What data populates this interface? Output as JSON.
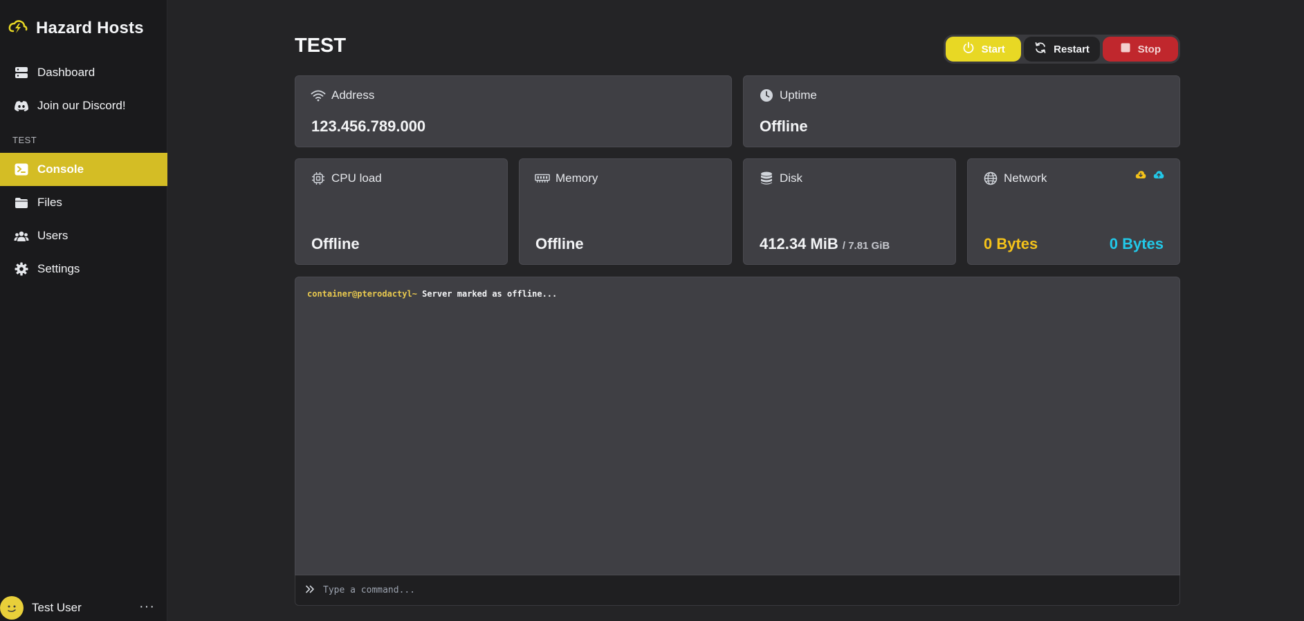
{
  "brand": {
    "name": "Hazard Hosts"
  },
  "nav": {
    "top_items": [
      {
        "label": "Dashboard",
        "icon": "server-stack-icon"
      },
      {
        "label": "Join our Discord!",
        "icon": "discord-icon"
      }
    ],
    "section_label": "TEST",
    "server_items": [
      {
        "label": "Console",
        "icon": "terminal-icon",
        "active": true
      },
      {
        "label": "Files",
        "icon": "folder-icon"
      },
      {
        "label": "Users",
        "icon": "users-icon"
      },
      {
        "label": "Settings",
        "icon": "gear-icon"
      }
    ]
  },
  "user": {
    "name": "Test User",
    "more": "···"
  },
  "server": {
    "title": "TEST"
  },
  "power": {
    "start": "Start",
    "restart": "Restart",
    "stop": "Stop"
  },
  "stats": {
    "address": {
      "label": "Address",
      "value": "123.456.789.000"
    },
    "uptime": {
      "label": "Uptime",
      "value": "Offline"
    },
    "cpu": {
      "label": "CPU load",
      "value": "Offline"
    },
    "memory": {
      "label": "Memory",
      "value": "Offline"
    },
    "disk": {
      "label": "Disk",
      "value": "412.34 MiB",
      "limit": "/ 7.81 GiB"
    },
    "network": {
      "label": "Network",
      "inbound": "0 Bytes",
      "outbound": "0 Bytes"
    }
  },
  "console": {
    "prompt": "container@pterodactyl~",
    "message": " Server marked as offline...",
    "placeholder": "Type a command..."
  },
  "colors": {
    "accent": "#d4bd25",
    "start": "#e8d824",
    "stop": "#c0272d",
    "inbound": "#f4c21a",
    "outbound": "#22c8e8"
  }
}
